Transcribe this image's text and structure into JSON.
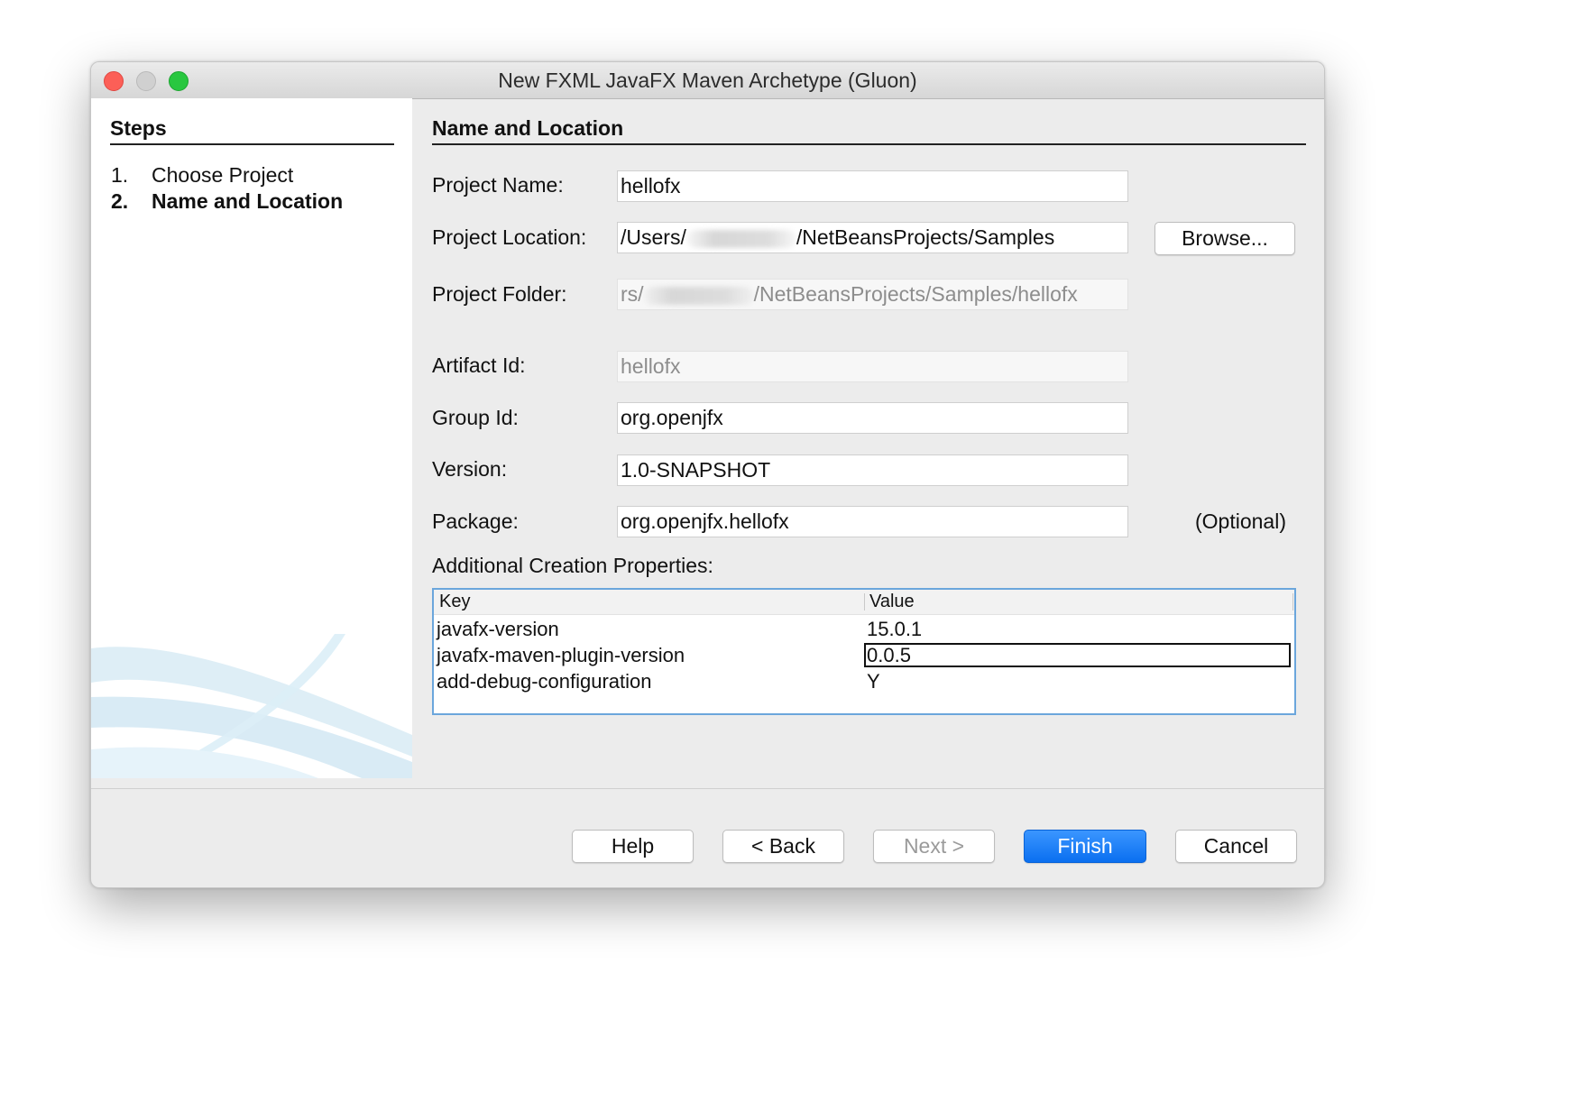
{
  "window": {
    "title": "New FXML JavaFX Maven Archetype (Gluon)"
  },
  "steps": {
    "title": "Steps",
    "items": [
      {
        "num": "1.",
        "label": "Choose Project"
      },
      {
        "num": "2.",
        "label": "Name and Location"
      }
    ]
  },
  "section": {
    "title": "Name and Location"
  },
  "form": {
    "project_name": {
      "label": "Project Name:",
      "value": "hellofx"
    },
    "project_location": {
      "label": "Project Location:",
      "prefix": "/Users/",
      "suffix": "/NetBeansProjects/Samples"
    },
    "browse_label": "Browse...",
    "project_folder": {
      "label": "Project Folder:",
      "prefix": "rs/",
      "suffix": "/NetBeansProjects/Samples/hellofx"
    },
    "artifact_id": {
      "label": "Artifact Id:",
      "value": "hellofx"
    },
    "group_id": {
      "label": "Group Id:",
      "value": "org.openjfx"
    },
    "version": {
      "label": "Version:",
      "value": "1.0-SNAPSHOT"
    },
    "package": {
      "label": "Package:",
      "value": "org.openjfx.hellofx",
      "optional": "(Optional)"
    }
  },
  "properties": {
    "title": "Additional Creation Properties:",
    "columns": {
      "key": "Key",
      "value": "Value"
    },
    "rows": [
      {
        "key": "javafx-version",
        "value": "15.0.1"
      },
      {
        "key": "javafx-maven-plugin-version",
        "value": "0.0.5"
      },
      {
        "key": "add-debug-configuration",
        "value": "Y"
      }
    ]
  },
  "buttons": {
    "help": "Help",
    "back": "< Back",
    "next": "Next >",
    "finish": "Finish",
    "cancel": "Cancel"
  },
  "colors": {
    "accent": "#0a6ff0",
    "table_border": "#6ba6dc",
    "close": "#fc5f57",
    "maximize": "#29c740"
  }
}
